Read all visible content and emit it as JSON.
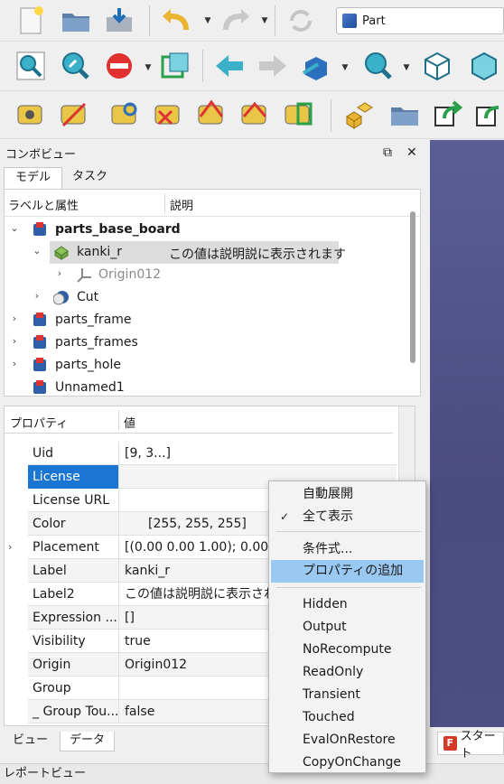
{
  "workbench": {
    "selected": "Part"
  },
  "combo": {
    "title": "コンボビュー",
    "tabs": [
      "モデル",
      "タスク"
    ],
    "tree_headers": {
      "label": "ラベルと属性",
      "description": "説明"
    },
    "tree_items": [
      {
        "label": "parts_base_board",
        "description": "",
        "expanded": true
      },
      {
        "label": "kanki_r",
        "description": "この値は説明説に表示されます",
        "expanded": true
      },
      {
        "label": "Origin012",
        "description": ""
      },
      {
        "label": "Cut",
        "description": ""
      },
      {
        "label": "parts_frame",
        "description": ""
      },
      {
        "label": "parts_frames",
        "description": ""
      },
      {
        "label": "parts_hole",
        "description": ""
      },
      {
        "label": "Unnamed1",
        "description": ""
      }
    ],
    "prop_headers": {
      "name": "プロパティ",
      "value": "値"
    },
    "properties": [
      {
        "name": "Uid",
        "value": "[9, 3...]"
      },
      {
        "name": "License",
        "value": ""
      },
      {
        "name": "License URL",
        "value": ""
      },
      {
        "name": "Color",
        "value": "[255, 255, 255]"
      },
      {
        "name": "Placement",
        "value": "[(0.00 0.00 1.00); 0.0000 °"
      },
      {
        "name": "Label",
        "value": "kanki_r"
      },
      {
        "name": "Label2",
        "value": "この値は説明説に表示されます"
      },
      {
        "name": "Expression ...",
        "value": "[]"
      },
      {
        "name": "Visibility",
        "value": "true"
      },
      {
        "name": "Origin",
        "value": "Origin012"
      },
      {
        "name": "Group",
        "value": ""
      },
      {
        "name": "_ Group Tou...",
        "value": "false"
      }
    ],
    "bottom_tabs": [
      "ビュー",
      "データ"
    ]
  },
  "context_menu": {
    "items": [
      {
        "label": "自動展開",
        "checked": false
      },
      {
        "label": "全て表示",
        "checked": true
      },
      {
        "label": "条件式...",
        "checked": false
      },
      {
        "label": "プロパティの追加",
        "checked": false,
        "highlighted": true
      },
      {
        "label": "Hidden"
      },
      {
        "label": "Output"
      },
      {
        "label": "NoRecompute"
      },
      {
        "label": "ReadOnly"
      },
      {
        "label": "Transient"
      },
      {
        "label": "Touched"
      },
      {
        "label": "EvalOnRestore"
      },
      {
        "label": "CopyOnChange"
      }
    ]
  },
  "report": {
    "title": "レポートビュー"
  },
  "start_tab": {
    "label": "スタート"
  },
  "icons": [
    "new-file",
    "open-folder",
    "save",
    "undo",
    "redo",
    "refresh",
    "zoom-fit",
    "zoom-selection",
    "draw-style",
    "bounding-box",
    "nav-back",
    "nav-forward",
    "std-views",
    "sync-view",
    "isometric",
    "front-view",
    "measure"
  ],
  "colors": {
    "accent": "#1a76d2",
    "menu_highlight": "#99c8f2",
    "viewport": "#4f5188"
  }
}
